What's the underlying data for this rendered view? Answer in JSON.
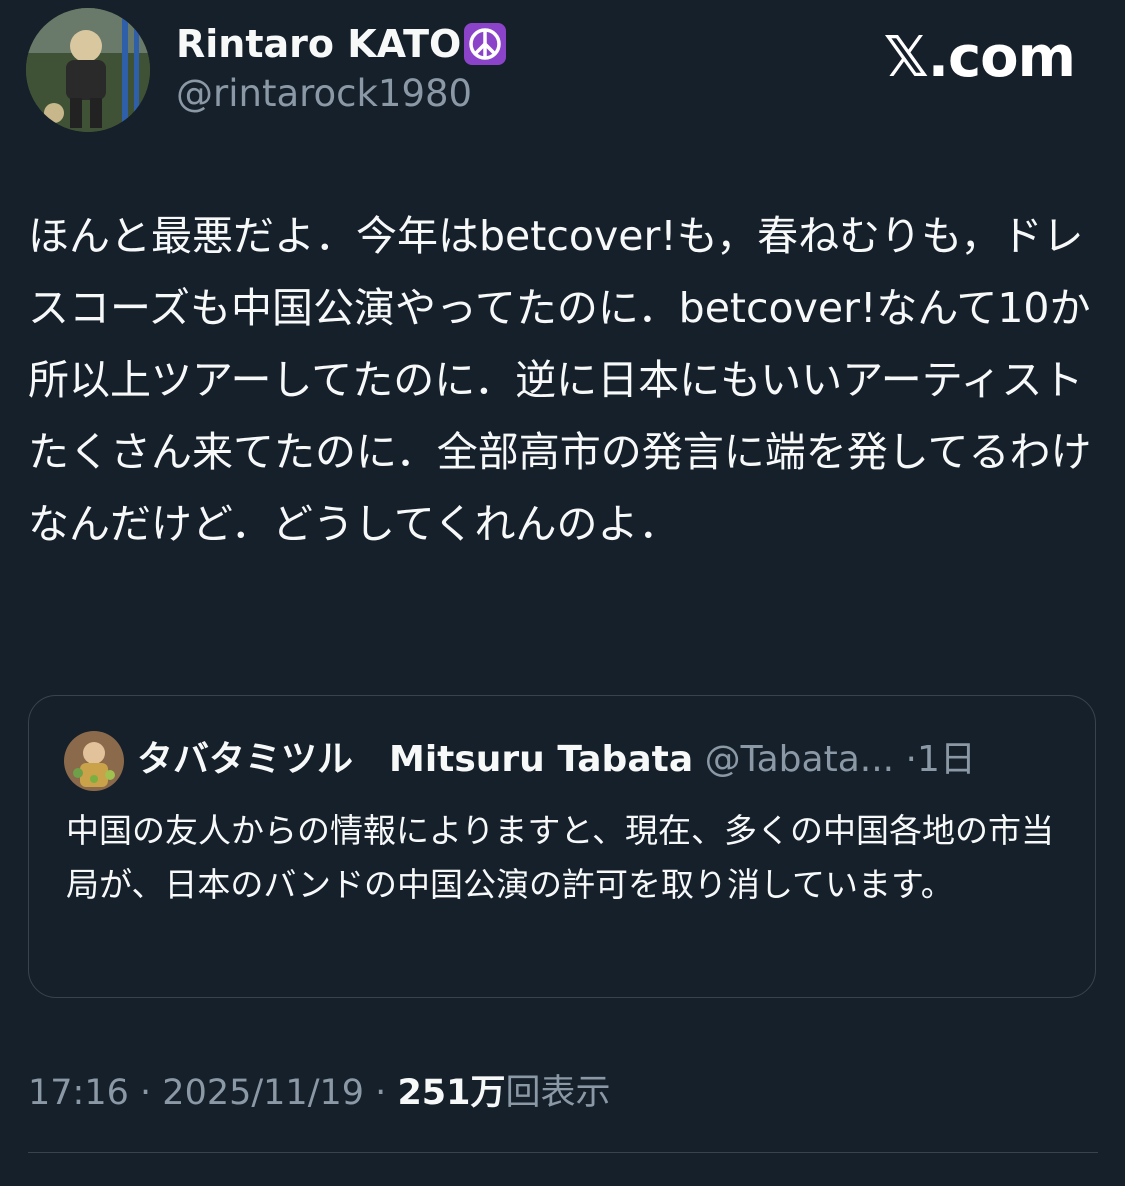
{
  "app": {
    "brand": "𝕏.com",
    "colors": {
      "background": "#15202b",
      "text_primary": "#f7f9f9",
      "text_secondary": "#8b98a5",
      "border": "#38444d",
      "badge_purple": "#8b44c9"
    }
  },
  "author": {
    "name": "Rintaro KATO",
    "badge_icon": "peace-symbol-icon",
    "handle": "@rintarock1980",
    "avatar_icon": "profile-photo-avatar"
  },
  "tweet": {
    "text": "ほんと最悪だよ．今年はbetcover!も，春ねむりも，ドレスコーズも中国公演やってたのに．betcover!なんて10か所以上ツアーしてたのに．逆に日本にもいいアーティストたくさん来てたのに．全部高市の発言に端を発してるわけなんだけど．どうしてくれんのよ．"
  },
  "quote": {
    "name": "タバタミツル　Mitsuru Tabata",
    "handle": "@Tabata...",
    "separator": "·",
    "time": "1日",
    "text": "中国の友人からの情報によりますと、現在、多くの中国各地の市当局が、日本のバンドの中国公演の許可を取り消しています。",
    "avatar_icon": "profile-photo-avatar"
  },
  "meta": {
    "time": "17:16",
    "separator": "·",
    "date": "2025/11/19",
    "views_count": "251万",
    "views_label": "回表示"
  }
}
